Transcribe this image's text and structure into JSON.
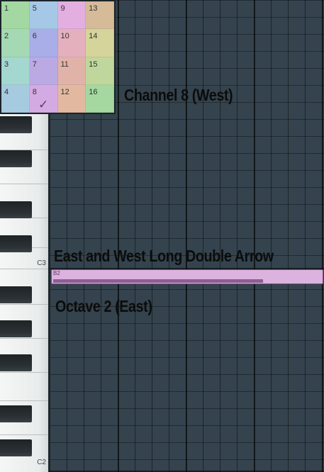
{
  "channel_grid": {
    "cells": [
      {
        "number": "1",
        "color": "#a3d8a3"
      },
      {
        "number": "5",
        "color": "#a5c8e6"
      },
      {
        "number": "9",
        "color": "#e3aee0"
      },
      {
        "number": "13",
        "color": "#d6bb98"
      },
      {
        "number": "2",
        "color": "#a5d9b3"
      },
      {
        "number": "6",
        "color": "#a9aee8"
      },
      {
        "number": "10",
        "color": "#e5b0bd"
      },
      {
        "number": "14",
        "color": "#d4d49b"
      },
      {
        "number": "3",
        "color": "#a3d7d0"
      },
      {
        "number": "7",
        "color": "#bba9e4"
      },
      {
        "number": "11",
        "color": "#e1b3a8"
      },
      {
        "number": "15",
        "color": "#bfd79c"
      },
      {
        "number": "4",
        "color": "#a6cbe0"
      },
      {
        "number": "8",
        "color": "#d4aae2"
      },
      {
        "number": "12",
        "color": "#e2b9a0"
      },
      {
        "number": "16",
        "color": "#a4d8a0"
      }
    ],
    "selected": "8"
  },
  "keyboard": {
    "labels": [
      "C3",
      "C2"
    ]
  },
  "note": {
    "label": "B2",
    "color": "#dcb2de"
  },
  "callouts": {
    "channel": "Channel 8 (West)",
    "arrow": "East and West Long Double Arrow",
    "octave": "Octave 2 (East)"
  }
}
